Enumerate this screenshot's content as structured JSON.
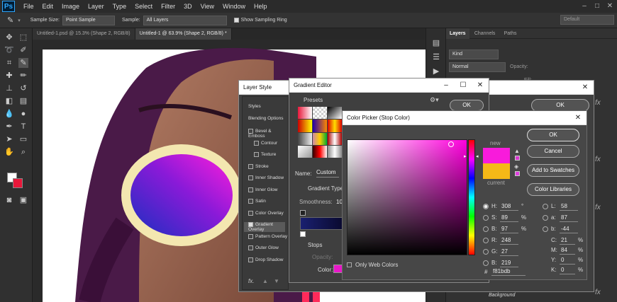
{
  "menubar": {
    "logo": "Ps",
    "items": [
      "File",
      "Edit",
      "Image",
      "Layer",
      "Type",
      "Select",
      "Filter",
      "3D",
      "View",
      "Window",
      "Help"
    ]
  },
  "optbar": {
    "sample_size_label": "Sample Size:",
    "sample_size_value": "Point Sample",
    "sample_label": "Sample:",
    "sample_value": "All Layers",
    "show_ring_label": "Show Sampling Ring",
    "workspace_value": "Default"
  },
  "tabs": [
    {
      "label": "Untitled-1.psd @ 15.3% (Shape 2, RGB/8)"
    },
    {
      "label": "Untitled-1 @ 63.9% (Shape 2, RGB/8) *"
    }
  ],
  "layers_panel": {
    "tabs": [
      "Layers",
      "Channels",
      "Paths"
    ],
    "kind_label": "Kind",
    "blend_mode": "Normal",
    "opacity_label": "Opacity:",
    "fill_label": "Fill:",
    "bottom_layer": "Background"
  },
  "layer_style": {
    "title": "Layer Style",
    "styles_label": "Styles",
    "blending_options": "Blending Options",
    "effects": [
      {
        "label": "Bevel & Emboss",
        "checked": false,
        "indent": false
      },
      {
        "label": "Contour",
        "checked": false,
        "indent": true
      },
      {
        "label": "Texture",
        "checked": false,
        "indent": true
      },
      {
        "label": "Stroke",
        "checked": false,
        "indent": false
      },
      {
        "label": "Inner Shadow",
        "checked": false,
        "indent": false
      },
      {
        "label": "Inner Glow",
        "checked": false,
        "indent": false
      },
      {
        "label": "Satin",
        "checked": false,
        "indent": false
      },
      {
        "label": "Color Overlay",
        "checked": false,
        "indent": false
      },
      {
        "label": "Gradient Overlay",
        "checked": true,
        "indent": false
      },
      {
        "label": "Pattern Overlay",
        "checked": false,
        "indent": false
      },
      {
        "label": "Outer Glow",
        "checked": false,
        "indent": false
      },
      {
        "label": "Drop Shadow",
        "checked": false,
        "indent": false
      }
    ],
    "fx_label": "fx.",
    "ok_label": "OK"
  },
  "gradient_editor": {
    "title": "Gradient Editor",
    "presets_label": "Presets",
    "name_label": "Name:",
    "name_value": "Custom",
    "gradient_type_label": "Gradient Type",
    "smoothness_label": "Smoothness:",
    "smoothness_value": "10",
    "stops_label": "Stops",
    "opacity_label": "Opacity:",
    "color_label": "Color:",
    "ok_label": "OK"
  },
  "color_picker": {
    "title": "Color Picker (Stop Color)",
    "ok_label": "OK",
    "cancel_label": "Cancel",
    "add_swatches_label": "Add to Swatches",
    "color_libraries_label": "Color Libraries",
    "new_label": "new",
    "current_label": "current",
    "new_color": "#f81bdb",
    "current_color": "#f5b917",
    "only_web_colors_label": "Only Web Colors",
    "hsb": [
      {
        "label": "H:",
        "value": "308",
        "unit": "°",
        "selected": true
      },
      {
        "label": "S:",
        "value": "89",
        "unit": "%",
        "selected": false
      },
      {
        "label": "B:",
        "value": "97",
        "unit": "%",
        "selected": false
      }
    ],
    "rgb": [
      {
        "label": "R:",
        "value": "248"
      },
      {
        "label": "G:",
        "value": "27"
      },
      {
        "label": "B:",
        "value": "219"
      }
    ],
    "lab": [
      {
        "label": "L:",
        "value": "58"
      },
      {
        "label": "a:",
        "value": "87"
      },
      {
        "label": "b:",
        "value": "-44"
      }
    ],
    "cmyk": [
      {
        "label": "C:",
        "value": "21",
        "unit": "%"
      },
      {
        "label": "M:",
        "value": "84",
        "unit": "%"
      },
      {
        "label": "Y:",
        "value": "0",
        "unit": "%"
      },
      {
        "label": "K:",
        "value": "0",
        "unit": "%"
      }
    ],
    "hex_label": "#",
    "hex_value": "f81bdb"
  },
  "colors": {
    "accent": "#f81bdb",
    "foreground_swatch": "#ffffff",
    "background_swatch": "#e8173a",
    "hue_base": "#ff00dd"
  }
}
